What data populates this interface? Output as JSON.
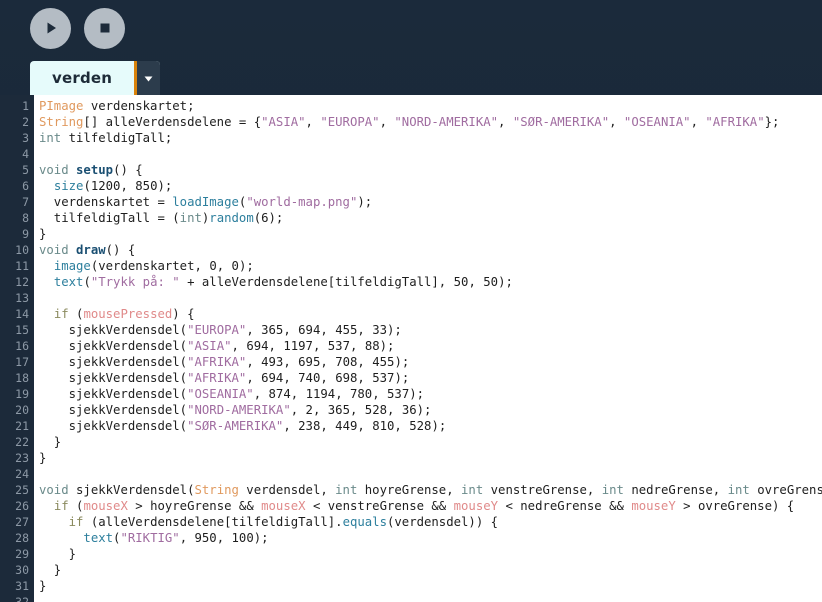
{
  "toolbar": {
    "run_label": "Run",
    "stop_label": "Stop",
    "run_icon": "play-icon",
    "stop_icon": "stop-icon"
  },
  "tab": {
    "name": "verden",
    "caret_icon": "chevron-down-icon"
  },
  "colors": {
    "header_bg": "#1b2a3b",
    "gutter_bg": "#1c2a3a",
    "editor_bg": "#ffffff",
    "tab_bg": "#e6fbfb",
    "tab_accent": "#d9820a",
    "button_bg": "#b4bcc4",
    "type": "#e0995e",
    "keyword": "#6a8a8a",
    "control": "#8a8a5e",
    "function": "#2d7f9d",
    "string": "#a06ca0",
    "variable": "#e08a8a"
  },
  "editor": {
    "line_numbers": [
      "1",
      "2",
      "3",
      "4",
      "5",
      "6",
      "7",
      "8",
      "9",
      "10",
      "11",
      "12",
      "13",
      "14",
      "15",
      "16",
      "17",
      "18",
      "19",
      "20",
      "21",
      "22",
      "23",
      "24",
      "25",
      "26",
      "27",
      "28",
      "29",
      "30",
      "31",
      "32"
    ],
    "lines": [
      [
        {
          "t": "type",
          "v": "PImage"
        },
        {
          "t": "plain",
          "v": " verdenskartet;"
        }
      ],
      [
        {
          "t": "type",
          "v": "String"
        },
        {
          "t": "plain",
          "v": "[] alleVerdensdelene = {"
        },
        {
          "t": "str",
          "v": "\"ASIA\""
        },
        {
          "t": "plain",
          "v": ", "
        },
        {
          "t": "str",
          "v": "\"EUROPA\""
        },
        {
          "t": "plain",
          "v": ", "
        },
        {
          "t": "str",
          "v": "\"NORD-AMERIKA\""
        },
        {
          "t": "plain",
          "v": ", "
        },
        {
          "t": "str",
          "v": "\"SØR-AMERIKA\""
        },
        {
          "t": "plain",
          "v": ", "
        },
        {
          "t": "str",
          "v": "\"OSEANIA\""
        },
        {
          "t": "plain",
          "v": ", "
        },
        {
          "t": "str",
          "v": "\"AFRIKA\""
        },
        {
          "t": "plain",
          "v": "};"
        }
      ],
      [
        {
          "t": "kw",
          "v": "int"
        },
        {
          "t": "plain",
          "v": " tilfeldigTall;"
        }
      ],
      [],
      [
        {
          "t": "kw",
          "v": "void"
        },
        {
          "t": "plain",
          "v": " "
        },
        {
          "t": "fdef",
          "v": "setup"
        },
        {
          "t": "plain",
          "v": "() {"
        }
      ],
      [
        {
          "t": "plain",
          "v": "  "
        },
        {
          "t": "fname",
          "v": "size"
        },
        {
          "t": "plain",
          "v": "("
        },
        {
          "t": "num",
          "v": "1200"
        },
        {
          "t": "plain",
          "v": ", "
        },
        {
          "t": "num",
          "v": "850"
        },
        {
          "t": "plain",
          "v": ");"
        }
      ],
      [
        {
          "t": "plain",
          "v": "  verdenskartet = "
        },
        {
          "t": "fname",
          "v": "loadImage"
        },
        {
          "t": "plain",
          "v": "("
        },
        {
          "t": "str",
          "v": "\"world-map.png\""
        },
        {
          "t": "plain",
          "v": ");"
        }
      ],
      [
        {
          "t": "plain",
          "v": "  tilfeldigTall = ("
        },
        {
          "t": "kw",
          "v": "int"
        },
        {
          "t": "plain",
          "v": ")"
        },
        {
          "t": "fname",
          "v": "random"
        },
        {
          "t": "plain",
          "v": "("
        },
        {
          "t": "num",
          "v": "6"
        },
        {
          "t": "plain",
          "v": ");"
        }
      ],
      [
        {
          "t": "plain",
          "v": "}"
        }
      ],
      [
        {
          "t": "kw",
          "v": "void"
        },
        {
          "t": "plain",
          "v": " "
        },
        {
          "t": "fdef",
          "v": "draw"
        },
        {
          "t": "plain",
          "v": "() {"
        }
      ],
      [
        {
          "t": "plain",
          "v": "  "
        },
        {
          "t": "fname",
          "v": "image"
        },
        {
          "t": "plain",
          "v": "(verdenskartet, "
        },
        {
          "t": "num",
          "v": "0"
        },
        {
          "t": "plain",
          "v": ", "
        },
        {
          "t": "num",
          "v": "0"
        },
        {
          "t": "plain",
          "v": ");"
        }
      ],
      [
        {
          "t": "plain",
          "v": "  "
        },
        {
          "t": "fname",
          "v": "text"
        },
        {
          "t": "plain",
          "v": "("
        },
        {
          "t": "str",
          "v": "\"Trykk på: \""
        },
        {
          "t": "plain",
          "v": " + alleVerdensdelene[tilfeldigTall], "
        },
        {
          "t": "num",
          "v": "50"
        },
        {
          "t": "plain",
          "v": ", "
        },
        {
          "t": "num",
          "v": "50"
        },
        {
          "t": "plain",
          "v": ");"
        }
      ],
      [],
      [
        {
          "t": "plain",
          "v": "  "
        },
        {
          "t": "ctl",
          "v": "if"
        },
        {
          "t": "plain",
          "v": " ("
        },
        {
          "t": "var",
          "v": "mousePressed"
        },
        {
          "t": "plain",
          "v": ") {"
        }
      ],
      [
        {
          "t": "plain",
          "v": "    sjekkVerdensdel("
        },
        {
          "t": "str",
          "v": "\"EUROPA\""
        },
        {
          "t": "plain",
          "v": ", "
        },
        {
          "t": "num",
          "v": "365"
        },
        {
          "t": "plain",
          "v": ", "
        },
        {
          "t": "num",
          "v": "694"
        },
        {
          "t": "plain",
          "v": ", "
        },
        {
          "t": "num",
          "v": "455"
        },
        {
          "t": "plain",
          "v": ", "
        },
        {
          "t": "num",
          "v": "33"
        },
        {
          "t": "plain",
          "v": ");"
        }
      ],
      [
        {
          "t": "plain",
          "v": "    sjekkVerdensdel("
        },
        {
          "t": "str",
          "v": "\"ASIA\""
        },
        {
          "t": "plain",
          "v": ", "
        },
        {
          "t": "num",
          "v": "694"
        },
        {
          "t": "plain",
          "v": ", "
        },
        {
          "t": "num",
          "v": "1197"
        },
        {
          "t": "plain",
          "v": ", "
        },
        {
          "t": "num",
          "v": "537"
        },
        {
          "t": "plain",
          "v": ", "
        },
        {
          "t": "num",
          "v": "88"
        },
        {
          "t": "plain",
          "v": ");"
        }
      ],
      [
        {
          "t": "plain",
          "v": "    sjekkVerdensdel("
        },
        {
          "t": "str",
          "v": "\"AFRIKA\""
        },
        {
          "t": "plain",
          "v": ", "
        },
        {
          "t": "num",
          "v": "493"
        },
        {
          "t": "plain",
          "v": ", "
        },
        {
          "t": "num",
          "v": "695"
        },
        {
          "t": "plain",
          "v": ", "
        },
        {
          "t": "num",
          "v": "708"
        },
        {
          "t": "plain",
          "v": ", "
        },
        {
          "t": "num",
          "v": "455"
        },
        {
          "t": "plain",
          "v": ");"
        }
      ],
      [
        {
          "t": "plain",
          "v": "    sjekkVerdensdel("
        },
        {
          "t": "str",
          "v": "\"AFRIKA\""
        },
        {
          "t": "plain",
          "v": ", "
        },
        {
          "t": "num",
          "v": "694"
        },
        {
          "t": "plain",
          "v": ", "
        },
        {
          "t": "num",
          "v": "740"
        },
        {
          "t": "plain",
          "v": ", "
        },
        {
          "t": "num",
          "v": "698"
        },
        {
          "t": "plain",
          "v": ", "
        },
        {
          "t": "num",
          "v": "537"
        },
        {
          "t": "plain",
          "v": ");"
        }
      ],
      [
        {
          "t": "plain",
          "v": "    sjekkVerdensdel("
        },
        {
          "t": "str",
          "v": "\"OSEANIA\""
        },
        {
          "t": "plain",
          "v": ", "
        },
        {
          "t": "num",
          "v": "874"
        },
        {
          "t": "plain",
          "v": ", "
        },
        {
          "t": "num",
          "v": "1194"
        },
        {
          "t": "plain",
          "v": ", "
        },
        {
          "t": "num",
          "v": "780"
        },
        {
          "t": "plain",
          "v": ", "
        },
        {
          "t": "num",
          "v": "537"
        },
        {
          "t": "plain",
          "v": ");"
        }
      ],
      [
        {
          "t": "plain",
          "v": "    sjekkVerdensdel("
        },
        {
          "t": "str",
          "v": "\"NORD-AMERIKA\""
        },
        {
          "t": "plain",
          "v": ", "
        },
        {
          "t": "num",
          "v": "2"
        },
        {
          "t": "plain",
          "v": ", "
        },
        {
          "t": "num",
          "v": "365"
        },
        {
          "t": "plain",
          "v": ", "
        },
        {
          "t": "num",
          "v": "528"
        },
        {
          "t": "plain",
          "v": ", "
        },
        {
          "t": "num",
          "v": "36"
        },
        {
          "t": "plain",
          "v": ");"
        }
      ],
      [
        {
          "t": "plain",
          "v": "    sjekkVerdensdel("
        },
        {
          "t": "str",
          "v": "\"SØR-AMERIKA\""
        },
        {
          "t": "plain",
          "v": ", "
        },
        {
          "t": "num",
          "v": "238"
        },
        {
          "t": "plain",
          "v": ", "
        },
        {
          "t": "num",
          "v": "449"
        },
        {
          "t": "plain",
          "v": ", "
        },
        {
          "t": "num",
          "v": "810"
        },
        {
          "t": "plain",
          "v": ", "
        },
        {
          "t": "num",
          "v": "528"
        },
        {
          "t": "plain",
          "v": ");"
        }
      ],
      [
        {
          "t": "plain",
          "v": "  }"
        }
      ],
      [
        {
          "t": "plain",
          "v": "}"
        }
      ],
      [],
      [
        {
          "t": "kw",
          "v": "void"
        },
        {
          "t": "plain",
          "v": " sjekkVerdensdel("
        },
        {
          "t": "type",
          "v": "String"
        },
        {
          "t": "plain",
          "v": " verdensdel, "
        },
        {
          "t": "kw",
          "v": "int"
        },
        {
          "t": "plain",
          "v": " hoyreGrense, "
        },
        {
          "t": "kw",
          "v": "int"
        },
        {
          "t": "plain",
          "v": " venstreGrense, "
        },
        {
          "t": "kw",
          "v": "int"
        },
        {
          "t": "plain",
          "v": " nedreGrense, "
        },
        {
          "t": "kw",
          "v": "int"
        },
        {
          "t": "plain",
          "v": " ovreGrense) {"
        }
      ],
      [
        {
          "t": "plain",
          "v": "  "
        },
        {
          "t": "ctl",
          "v": "if"
        },
        {
          "t": "plain",
          "v": " ("
        },
        {
          "t": "var",
          "v": "mouseX"
        },
        {
          "t": "plain",
          "v": " > hoyreGrense && "
        },
        {
          "t": "var",
          "v": "mouseX"
        },
        {
          "t": "plain",
          "v": " < venstreGrense && "
        },
        {
          "t": "var",
          "v": "mouseY"
        },
        {
          "t": "plain",
          "v": " < nedreGrense && "
        },
        {
          "t": "var",
          "v": "mouseY"
        },
        {
          "t": "plain",
          "v": " > ovreGrense) {"
        }
      ],
      [
        {
          "t": "plain",
          "v": "    "
        },
        {
          "t": "ctl",
          "v": "if"
        },
        {
          "t": "plain",
          "v": " (alleVerdensdelene[tilfeldigTall]."
        },
        {
          "t": "fname",
          "v": "equals"
        },
        {
          "t": "plain",
          "v": "(verdensdel)) {"
        }
      ],
      [
        {
          "t": "plain",
          "v": "      "
        },
        {
          "t": "fname",
          "v": "text"
        },
        {
          "t": "plain",
          "v": "("
        },
        {
          "t": "str",
          "v": "\"RIKTIG\""
        },
        {
          "t": "plain",
          "v": ", "
        },
        {
          "t": "num",
          "v": "950"
        },
        {
          "t": "plain",
          "v": ", "
        },
        {
          "t": "num",
          "v": "100"
        },
        {
          "t": "plain",
          "v": ");"
        }
      ],
      [
        {
          "t": "plain",
          "v": "    }"
        }
      ],
      [
        {
          "t": "plain",
          "v": "  }"
        }
      ],
      [
        {
          "t": "plain",
          "v": "}"
        }
      ],
      []
    ]
  }
}
